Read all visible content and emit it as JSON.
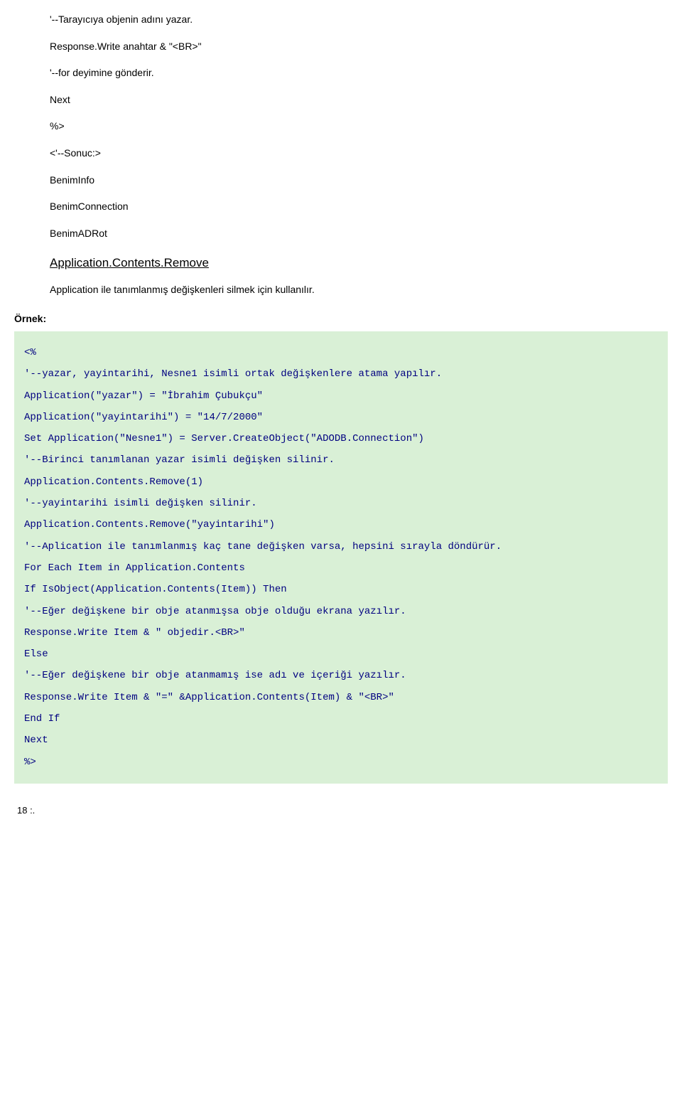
{
  "intro": {
    "line1": "'--Tarayıcıya objenin adını yazar.",
    "line2": "Response.Write anahtar & \"<BR>\"",
    "line3": "'--for deyimine gönderir.",
    "line4": "Next",
    "line5": "%>",
    "line6": "<'--Sonuc:>",
    "line7": "BenimInfo",
    "line8": "BenimConnection",
    "line9": "BenimADRot"
  },
  "heading": "Application.Contents.Remove",
  "desc": "Application ile tanımlanmış değişkenleri silmek için kullanılır.",
  "ornek_label": "Örnek:",
  "code": {
    "l0": "<%",
    "l1": "'--yazar, yayintarihi, Nesne1 isimli ortak değişkenlere atama yapılır.",
    "l2": "Application(\"yazar\") = \"İbrahim Çubukçu\"",
    "l3": "Application(\"yayintarihi\") = \"14/7/2000\"",
    "l4": "Set Application(\"Nesne1\") = Server.CreateObject(\"ADODB.Connection\")",
    "l5": "'--Birinci tanımlanan yazar isimli değişken silinir.",
    "l6": "Application.Contents.Remove(1)",
    "l7": "'--yayintarihi isimli değişken silinir.",
    "l8": "Application.Contents.Remove(\"yayintarihi\")",
    "l9": "'--Aplication ile tanımlanmış kaç tane değişken varsa, hepsini sırayla döndürür.",
    "l10": "For Each Item in Application.Contents",
    "l11": "If IsObject(Application.Contents(Item)) Then",
    "l12": "'--Eğer değişkene bir obje atanmışsa obje olduğu ekrana yazılır.",
    "l13": "Response.Write Item & \" objedir.<BR>\"",
    "l14": "Else",
    "l15": "'--Eğer değişkene bir obje atanmamış ise adı ve içeriği yazılır.",
    "l16": "Response.Write Item & \"=\" &Application.Contents(Item) & \"<BR>\"",
    "l17": "End If",
    "l18": "Next",
    "l19": "%>"
  },
  "footer": "18 :."
}
